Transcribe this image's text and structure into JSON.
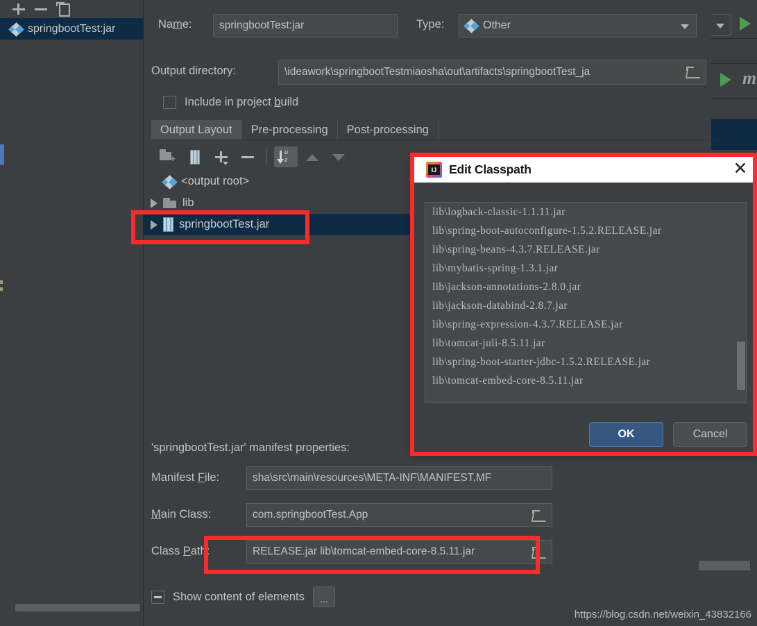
{
  "left_panel": {
    "toolbar": [
      {
        "name": "add-artifact-button",
        "icon": "plus-icon",
        "label": "+"
      },
      {
        "name": "remove-artifact-button",
        "icon": "minus-icon",
        "label": "−"
      },
      {
        "name": "copy-artifact-button",
        "icon": "copy-icon",
        "label": ""
      }
    ],
    "items": [
      {
        "label": "springbootTest:jar",
        "icon": "artifact-diamond-icon",
        "selected": true
      }
    ]
  },
  "artifact": {
    "name_label": "Na",
    "name_label_accel": "m",
    "name_label_rest": "e:",
    "name_value": "springbootTest:jar",
    "type_label": "Type:",
    "type_value": "Other",
    "output_dir_label": "Output directory:",
    "output_dir_value": "\\ideawork\\springbootTestmiaosha\\out\\artifacts\\springbootTest_ja",
    "include_checkbox_label_pre": "Include in project ",
    "include_checkbox_accel": "b",
    "include_checkbox_label_post": "uild",
    "tabs": [
      {
        "label": "Output Layout",
        "active": true
      },
      {
        "label": "Pre-processing",
        "active": false
      },
      {
        "label": "Post-processing",
        "active": false
      }
    ],
    "tree_toolbar": [
      {
        "name": "add-directory-button",
        "icon": "folder-add-icon"
      },
      {
        "name": "add-archive-button",
        "icon": "jar-icon"
      },
      {
        "name": "add-element-button",
        "icon": "plus-dropdown-icon"
      },
      {
        "name": "remove-element-button",
        "icon": "minus-icon"
      },
      {
        "name": "sort-by-name-button",
        "icon": "sort-az-icon"
      },
      {
        "name": "move-up-button",
        "icon": "arrow-up-icon"
      },
      {
        "name": "move-down-button",
        "icon": "arrow-down-icon"
      }
    ],
    "tree": [
      {
        "label": "<output root>",
        "icon": "artifact-diamond-icon",
        "expandable": false,
        "selected": false
      },
      {
        "label": "lib",
        "icon": "folder-icon",
        "expandable": true,
        "selected": false
      },
      {
        "label": "springbootTest.jar",
        "icon": "jar-icon",
        "expandable": true,
        "selected": true
      }
    ],
    "manifest_title": "'springbootTest.jar' manifest properties:",
    "manifest_file_label_pre": "Manifest ",
    "manifest_file_label_accel": "F",
    "manifest_file_label_post": "ile:",
    "manifest_file_value": "sha\\src\\main\\resources\\META-INF\\MANIFEST.MF",
    "main_class_label_accel": "M",
    "main_class_label_post": "ain Class:",
    "main_class_value": "com.springbootTest.App",
    "class_path_label_pre": "Class ",
    "class_path_label_accel": "P",
    "class_path_label_post": "ath:",
    "class_path_value": "RELEASE.jar lib\\tomcat-embed-core-8.5.11.jar",
    "show_content_label": "Show content of elements",
    "show_content_more_button": "..."
  },
  "dialog": {
    "title": "Edit Classpath",
    "icon": "intellij-idea-icon",
    "close_label": "✕",
    "classpath_lines": [
      "lib\\logback-classic-1.1.11.jar",
      "lib\\spring-boot-autoconfigure-1.5.2.RELEASE.jar",
      "lib\\spring-beans-4.3.7.RELEASE.jar",
      "lib\\mybatis-spring-1.3.1.jar",
      "lib\\jackson-annotations-2.8.0.jar",
      "lib\\jackson-databind-2.8.7.jar",
      "lib\\spring-expression-4.3.7.RELEASE.jar",
      "lib\\tomcat-juli-8.5.11.jar",
      "lib\\spring-boot-starter-jdbc-1.5.2.RELEASE.jar",
      "lib\\tomcat-embed-core-8.5.11.jar"
    ],
    "ok_label": "OK",
    "cancel_label": "Cancel"
  },
  "ide_background": {
    "run_italic_text": "m"
  },
  "watermark": "https://blog.csdn.net/weixin_43832166",
  "colors": {
    "accent_blue": "#4da6d8",
    "selection_blue": "#0d2b45",
    "annotation_red": "#fc2b2b",
    "ok_button": "#365880",
    "panel_bg": "#3c3f41",
    "field_bg": "#45494a"
  }
}
